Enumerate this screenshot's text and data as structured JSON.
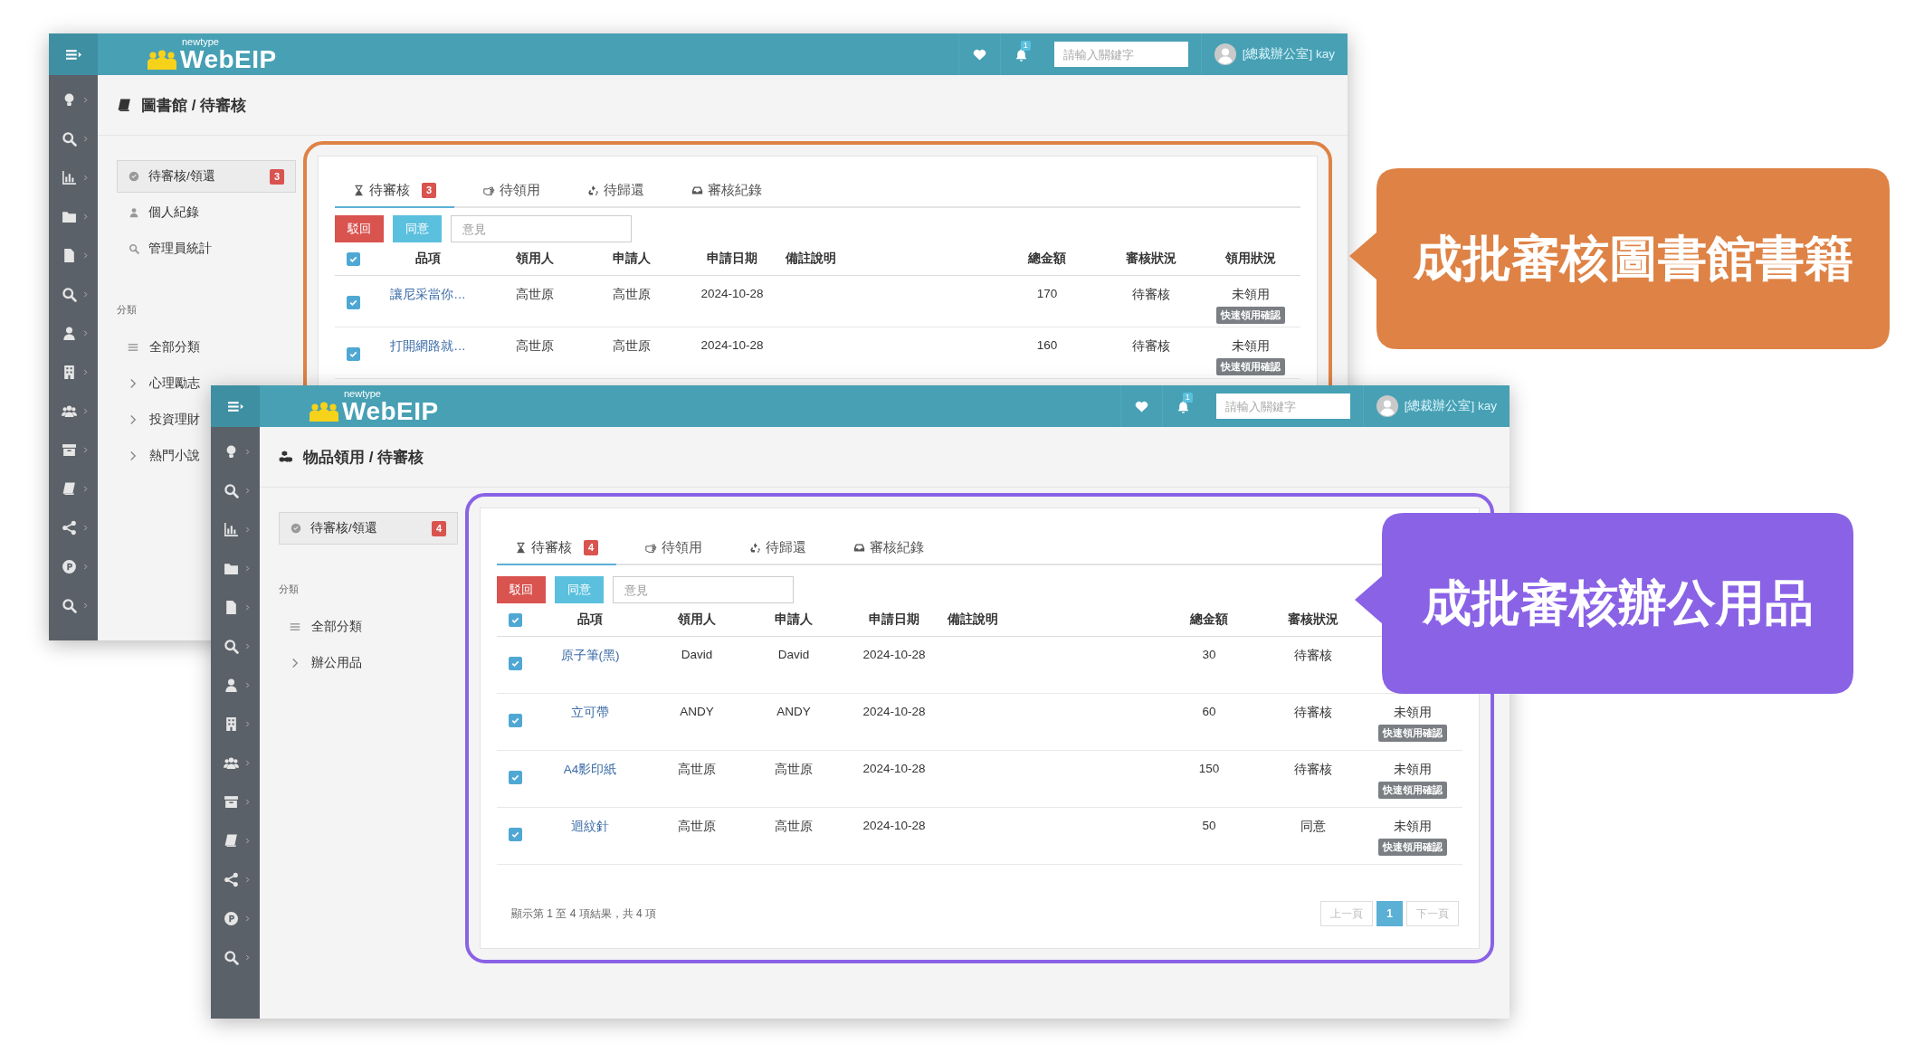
{
  "windows": [
    {
      "logo": {
        "subtitle": "newtype",
        "title": "WebEIP"
      },
      "notification_count": "1",
      "search": {
        "placeholder": "請輸入關鍵字"
      },
      "user": "[總裁辦公室] kay",
      "breadcrumb": "圖書館 / 待審核",
      "menu": [
        {
          "label": "待審核/領還",
          "badge": "3",
          "selected": true
        },
        {
          "label": "個人紀錄",
          "selected": false
        },
        {
          "label": "管理員統計",
          "selected": false
        }
      ],
      "category_heading": "分類",
      "categories": [
        "全部分類",
        "心理勵志",
        "投資理財",
        "熱門小說"
      ],
      "tabs": [
        {
          "label": "待審核",
          "badge": "3",
          "selected": true
        },
        {
          "label": "待領用",
          "selected": false
        },
        {
          "label": "待歸還",
          "selected": false
        },
        {
          "label": "審核紀錄",
          "selected": false
        }
      ],
      "reject_button": "駁回",
      "approve_button": "同意",
      "comment": {
        "placeholder": "意見"
      },
      "select_all_checked": true,
      "columns": [
        "品項",
        "領用人",
        "申請人",
        "申請日期",
        "備註說明",
        "總金額",
        "審核狀況",
        "領用狀況"
      ],
      "rows": [
        {
          "checked": true,
          "item": "讓尼采當你…",
          "recipient": "高世原",
          "applicant": "高世原",
          "date": "2024-10-28",
          "total": "170",
          "review_status": "待審核",
          "pickup_status": "未領用",
          "quick_confirm": "快速領用確認"
        },
        {
          "checked": true,
          "item": "打開網路就…",
          "recipient": "高世原",
          "applicant": "高世原",
          "date": "2024-10-28",
          "total": "160",
          "review_status": "待審核",
          "pickup_status": "未領用",
          "quick_confirm": "快速領用確認"
        }
      ]
    },
    {
      "logo": {
        "subtitle": "newtype",
        "title": "WebEIP"
      },
      "notification_count": "1",
      "search": {
        "placeholder": "請輸入關鍵字"
      },
      "user": "[總裁辦公室] kay",
      "breadcrumb": "物品領用 / 待審核",
      "menu": [
        {
          "label": "待審核/領還",
          "badge": "4",
          "selected": true
        }
      ],
      "category_heading": "分類",
      "categories": [
        "全部分類",
        "辦公用品"
      ],
      "tabs": [
        {
          "label": "待審核",
          "badge": "4",
          "selected": true
        },
        {
          "label": "待領用",
          "selected": false
        },
        {
          "label": "待歸還",
          "selected": false
        },
        {
          "label": "審核紀錄",
          "selected": false
        }
      ],
      "reject_button": "駁回",
      "approve_button": "同意",
      "comment": {
        "placeholder": "意見"
      },
      "select_all_checked": true,
      "columns": [
        "品項",
        "領用人",
        "申請人",
        "申請日期",
        "備註說明",
        "總金額",
        "審核狀況"
      ],
      "rows": [
        {
          "checked": true,
          "item": "原子筆(黑)",
          "recipient": "David",
          "applicant": "David",
          "date": "2024-10-28",
          "total": "30",
          "review_status": "待審核"
        },
        {
          "checked": true,
          "item": "立可帶",
          "recipient": "ANDY",
          "applicant": "ANDY",
          "date": "2024-10-28",
          "total": "60",
          "review_status": "待審核",
          "pickup_status": "未領用",
          "quick_confirm": "快速領用確認"
        },
        {
          "checked": true,
          "item": "A4影印紙",
          "recipient": "高世原",
          "applicant": "高世原",
          "date": "2024-10-28",
          "total": "150",
          "review_status": "待審核",
          "pickup_status": "未領用",
          "quick_confirm": "快速領用確認"
        },
        {
          "checked": true,
          "item": "迴紋針",
          "recipient": "高世原",
          "applicant": "高世原",
          "date": "2024-10-28",
          "total": "50",
          "review_status": "同意",
          "pickup_status": "未領用",
          "quick_confirm": "快速領用確認"
        }
      ],
      "footer": "顯示第 1 至 4 項結果，共 4 項",
      "pagination": [
        {
          "label": "上一頁",
          "selected": false,
          "disabled": true
        },
        {
          "label": "1",
          "selected": true,
          "disabled": false
        },
        {
          "label": "下一頁",
          "selected": false,
          "disabled": true
        }
      ]
    }
  ],
  "callouts": [
    {
      "text": "成批審核圖書館書籍",
      "color": "#de8245"
    },
    {
      "text": "成批審核辦公用品",
      "color": "#8a62e6"
    }
  ]
}
